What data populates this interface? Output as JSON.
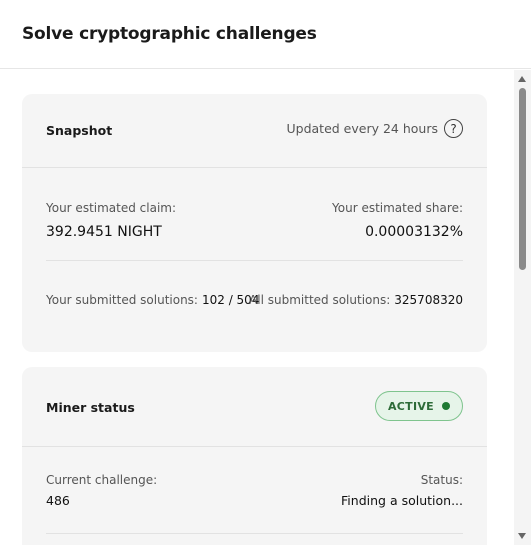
{
  "header": {
    "title": "Solve cryptographic challenges"
  },
  "snapshot": {
    "title": "Snapshot",
    "updated_text": "Updated every 24 hours",
    "help_glyph": "?",
    "claim_label": "Your estimated claim:",
    "claim_value": "392.9451 NIGHT",
    "share_label": "Your estimated share:",
    "share_value": "0.00003132%",
    "submitted_label": "Your submitted solutions:",
    "submitted_value": "102 / 504",
    "all_label": "All submitted solutions:",
    "all_value": "325708320"
  },
  "miner": {
    "title": "Miner status",
    "badge": "ACTIVE",
    "challenge_label": "Current challenge:",
    "challenge_value": "486",
    "status_label": "Status:",
    "status_value": "Finding a solution..."
  },
  "colors": {
    "badge_bg": "#e6f4e9",
    "badge_border": "#7fc48e",
    "badge_dot": "#1f7a33",
    "card_bg": "#f5f5f5"
  },
  "icons": {
    "help": "question-circle-icon",
    "status_dot": "active-dot-icon"
  }
}
